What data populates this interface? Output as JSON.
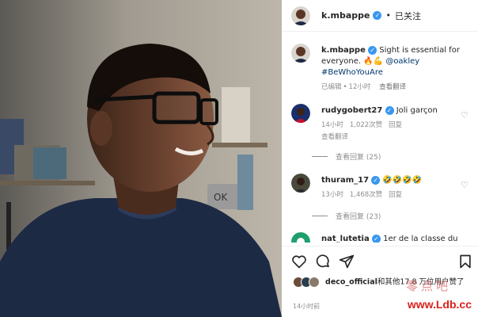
{
  "post": {
    "username": "k.mbappe",
    "follow_label": "已关注",
    "dot": "•",
    "caption_text": "Sight is essential for everyone. 🔥💪",
    "caption_mention": "@oakley",
    "caption_hashtag": "#BeWhoYouAre",
    "caption_edited": "已编辑",
    "caption_time": "12小时",
    "caption_translate": "查看翻译"
  },
  "comments": [
    {
      "username": "rudygobert27",
      "text": "Joli garçon",
      "time": "14小时",
      "likes": "1,022次赞",
      "reply": "回复",
      "translate": "查看翻译",
      "view_replies": "查看回复 (25)"
    },
    {
      "username": "thuram_17",
      "text": "🤣🤣🤣🤣",
      "time": "13小时",
      "likes": "1,468次赞",
      "reply": "回复",
      "view_replies": "查看回复 (23)"
    },
    {
      "username": "nat_lutetia",
      "text": "1er de la classe du"
    }
  ],
  "likes": {
    "liker": "deco_official",
    "text": "和其他17.8 万位用户赞了"
  },
  "time_ago": "14小时前",
  "watermark": {
    "cn": "零点吧",
    "url": "www.Ldb.cc"
  },
  "icons": {
    "heart": "heart-icon",
    "comment": "comment-icon",
    "share": "share-icon",
    "save": "bookmark-icon"
  },
  "colors": {
    "link": "#00376b",
    "verified": "#3897f0",
    "muted": "#8e8e8e",
    "sweater": "#1d2a44"
  }
}
